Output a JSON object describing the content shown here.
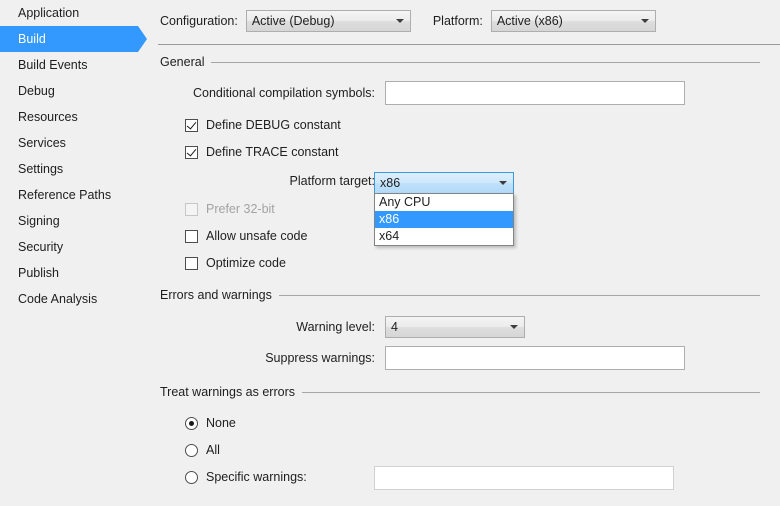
{
  "sidebar": {
    "items": [
      {
        "label": "Application",
        "selected": false
      },
      {
        "label": "Build",
        "selected": true
      },
      {
        "label": "Build Events",
        "selected": false
      },
      {
        "label": "Debug",
        "selected": false
      },
      {
        "label": "Resources",
        "selected": false
      },
      {
        "label": "Services",
        "selected": false
      },
      {
        "label": "Settings",
        "selected": false
      },
      {
        "label": "Reference Paths",
        "selected": false
      },
      {
        "label": "Signing",
        "selected": false
      },
      {
        "label": "Security",
        "selected": false
      },
      {
        "label": "Publish",
        "selected": false
      },
      {
        "label": "Code Analysis",
        "selected": false
      }
    ],
    "selected_color": "#3399ff"
  },
  "header": {
    "configuration_label": "Configuration:",
    "configuration_value": "Active (Debug)",
    "platform_label": "Platform:",
    "platform_value": "Active (x86)"
  },
  "general": {
    "title": "General",
    "conditional_symbols_label": "Conditional compilation symbols:",
    "conditional_symbols_value": "",
    "define_debug_label": "Define DEBUG constant",
    "define_debug_checked": true,
    "define_trace_label": "Define TRACE constant",
    "define_trace_checked": true,
    "platform_target_label": "Platform target:",
    "platform_target_value": "x86",
    "platform_target_options": [
      "Any CPU",
      "x86",
      "x64"
    ],
    "platform_target_highlighted": "x86",
    "prefer_32bit_label": "Prefer 32-bit",
    "prefer_32bit_checked": false,
    "prefer_32bit_disabled": true,
    "allow_unsafe_label": "Allow unsafe code",
    "allow_unsafe_checked": false,
    "optimize_code_label": "Optimize code",
    "optimize_code_checked": false
  },
  "errors_warnings": {
    "title": "Errors and warnings",
    "warning_level_label": "Warning level:",
    "warning_level_value": "4",
    "suppress_warnings_label": "Suppress warnings:",
    "suppress_warnings_value": ""
  },
  "treat_warnings": {
    "title": "Treat warnings as errors",
    "none_label": "None",
    "none_selected": true,
    "all_label": "All",
    "all_selected": false,
    "specific_label": "Specific warnings:",
    "specific_selected": false,
    "specific_value": "",
    "specific_disabled": true
  }
}
